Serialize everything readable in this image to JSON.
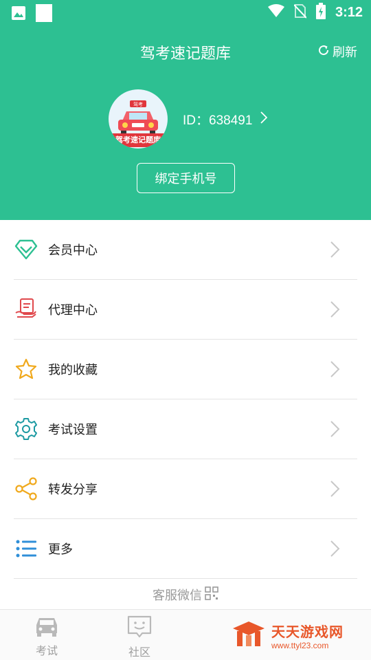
{
  "status_bar": {
    "time": "3:12",
    "icons": [
      "image-icon",
      "square-icon",
      "wifi-icon",
      "no-sim-icon",
      "battery-charging-icon"
    ]
  },
  "header": {
    "title": "驾考速记题库",
    "refresh_label": "刷新",
    "refresh_icon": "refresh-icon"
  },
  "profile": {
    "avatar_badge": "驾考",
    "avatar_caption": "驾考速记题库",
    "id_text": "ID：638491",
    "bind_phone_label": "绑定手机号"
  },
  "menu": {
    "items": [
      {
        "label": "会员中心",
        "icon": "diamond-icon"
      },
      {
        "label": "代理中心",
        "icon": "agent-hand-icon"
      },
      {
        "label": "我的收藏",
        "icon": "star-icon"
      },
      {
        "label": "考试设置",
        "icon": "gear-icon"
      },
      {
        "label": "转发分享",
        "icon": "share-icon"
      },
      {
        "label": "更多",
        "icon": "list-icon"
      }
    ]
  },
  "customer_service": {
    "label": "客服微信",
    "icon": "qr-code-icon"
  },
  "tabbar": {
    "tabs": [
      {
        "label": "考试",
        "icon": "car-icon"
      },
      {
        "label": "社区",
        "icon": "chat-icon"
      }
    ]
  },
  "watermark": {
    "title": "天天游戏网",
    "url": "www.ttyl23.com"
  },
  "colors": {
    "brand_green": "#2dc092",
    "icon_green": "#2dc092",
    "icon_red": "#e0484c",
    "icon_yellow": "#f0a91d",
    "icon_teal": "#1d9aa2",
    "icon_blue": "#2f8fd8",
    "watermark_orange": "#e8572a"
  }
}
